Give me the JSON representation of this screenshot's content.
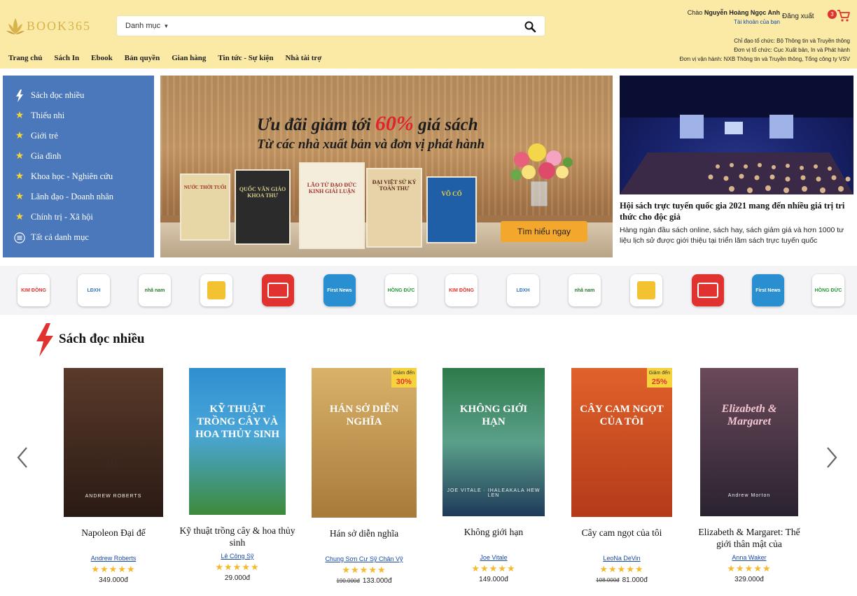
{
  "header": {
    "logo_text": "BOOK365",
    "search": {
      "category_label": "Danh mục"
    },
    "nav": [
      "Trang chủ",
      "Sách In",
      "Ebook",
      "Bản quyền",
      "Gian hàng",
      "Tin tức - Sự kiện",
      "Nhà tài trợ"
    ],
    "user": {
      "greeting": "Chào",
      "name": "Nguyễn Hoàng Ngọc Anh",
      "account": "Tài khoản của bạn",
      "logout": "Đăng xuất",
      "cart_count": "3"
    },
    "org": [
      "Chỉ đạo tổ chức: Bộ Thông tin và Truyền thông",
      "Đơn vị tổ chức: Cục Xuất bản, In và Phát hành",
      "Đơn vị vận hành: NXB Thông tin và Truyền thông, Tổng công ty VSV"
    ]
  },
  "sidebar": {
    "items": [
      {
        "label": "Sách đọc nhiều",
        "icon": "bolt-icon"
      },
      {
        "label": "Thiếu nhi",
        "icon": "star-icon"
      },
      {
        "label": "Giới trẻ",
        "icon": "star-icon"
      },
      {
        "label": "Gia đình",
        "icon": "star-icon"
      },
      {
        "label": "Khoa học - Nghiên cứu",
        "icon": "star-icon"
      },
      {
        "label": "Lãnh đạo - Doanh nhân",
        "icon": "star-icon"
      },
      {
        "label": "Chính trị - Xã hội",
        "icon": "star-icon"
      },
      {
        "label": "Tất cả danh mục",
        "icon": "menu-icon"
      }
    ]
  },
  "banner": {
    "headline_pre": "Ưu đãi giảm tới ",
    "headline_pct": "60%",
    "headline_post": " giá sách",
    "subheadline": "Từ các nhà xuất bản và đơn vị phát hành",
    "cta": "Tìm hiểu ngay",
    "books": [
      "NƯỚC THỜI TUỔI",
      "QUỐC VĂN GIÁO KHOA THƯ",
      "LÃO TỬ ĐẠO ĐỨC KINH GIẢI LUẬN",
      "ĐẠI VIỆT SỬ KÝ TOÀN THƯ",
      "VÕ CỔ"
    ]
  },
  "news": {
    "title": "Hội sách trực tuyến quốc gia 2021 mang đến nhiều giá trị tri thức cho độc giả",
    "desc": "Hàng ngàn đầu sách online, sách hay, sách giảm giá và hơn 1000 tư liệu lịch sử được giới thiệu tại triển lãm sách trực tuyến quốc"
  },
  "publishers": [
    {
      "label": "KIM ĐỒNG",
      "color": "#e0322e"
    },
    {
      "label": "LĐXH",
      "color": "#3a78c2"
    },
    {
      "label": "nhã nam",
      "color": "#2a7a2e"
    },
    {
      "label": "",
      "color": "#f2c230"
    },
    {
      "label": "",
      "color": "#e0322e"
    },
    {
      "label": "First News",
      "color": "#2a8fd0"
    },
    {
      "label": "HỒNG ĐỨC",
      "color": "#2a9a3e"
    },
    {
      "label": "KIM ĐỒNG",
      "color": "#e0322e"
    },
    {
      "label": "LĐXH",
      "color": "#3a78c2"
    },
    {
      "label": "nhã nam",
      "color": "#2a7a2e"
    },
    {
      "label": "",
      "color": "#f2c230"
    },
    {
      "label": "",
      "color": "#e0322e"
    },
    {
      "label": "First News",
      "color": "#2a8fd0"
    },
    {
      "label": "HỒNG ĐỨC",
      "color": "#2a9a3e"
    }
  ],
  "section": {
    "title": "Sách đọc nhiều"
  },
  "books": [
    {
      "title": "Napoleon Đại đế",
      "author": "Andrew Roberts",
      "price": "349.000đ",
      "old_price": "",
      "discount": "",
      "cover_title": "NAPOLEON ĐẠI ĐẾ",
      "cover_sub": "ANDREW ROBERTS",
      "rating": 5
    },
    {
      "title": "Kỹ thuật trồng cây & hoa thủy sinh",
      "author": "Lê Công Sỹ",
      "price": "29.000đ",
      "old_price": "",
      "discount": "",
      "cover_title": "KỸ THUẬT TRỒNG CÂY VÀ HOA THỦY SINH",
      "cover_sub": "",
      "rating": 5
    },
    {
      "title": "Hán sở diễn nghĩa",
      "author": "Chung Sơn Cư Sỹ Chân Vỹ",
      "price": "133.000đ",
      "old_price": "190.000đ",
      "discount": "30%",
      "cover_title": "HÁN SỞ DIỄN NGHĨA",
      "cover_sub": "",
      "rating": 5
    },
    {
      "title": "Không giới hạn",
      "author": "Joe Vitale",
      "price": "149.000đ",
      "old_price": "",
      "discount": "",
      "cover_title": "KHÔNG GIỚI HẠN",
      "cover_sub": "JOE VITALE · IHALEAKALA HEW LEN",
      "rating": 5
    },
    {
      "title": "Cây cam ngọt của tôi",
      "author": "LeoNa DeVin",
      "price": "81.000đ",
      "old_price": "108.000đ",
      "discount": "25%",
      "cover_title": "CÂY CAM NGỌT CỦA TÔI",
      "cover_sub": "",
      "rating": 5
    },
    {
      "title": "Elizabeth & Margaret: Thế giới thân mật của",
      "author": "Anna Waker",
      "price": "329.000đ",
      "old_price": "",
      "discount": "",
      "cover_title": "Elizabeth & Margaret",
      "cover_sub": "Andrew Morton",
      "rating": 5
    }
  ],
  "discount_label": "Giảm đến",
  "colors": {
    "header_bg": "#fbeaa5",
    "sidebar_bg": "#4a78ba",
    "accent_red": "#e0232c",
    "star": "#f6b92a",
    "link": "#1a4aa8"
  }
}
